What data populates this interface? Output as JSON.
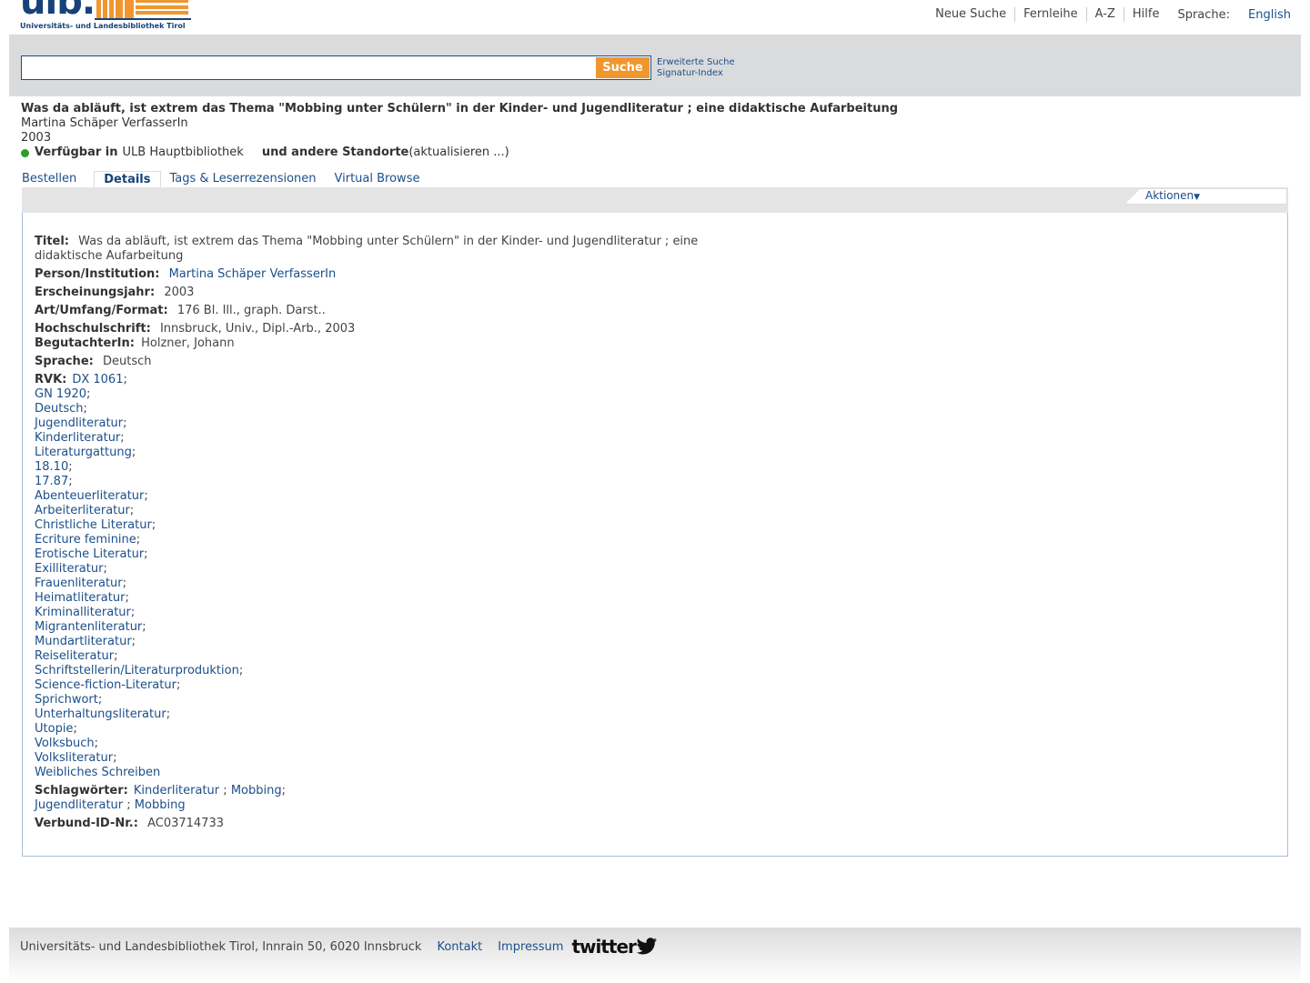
{
  "header": {
    "logo_text": "ulb.",
    "logo_subtitle": "Universitäts- und Landesbibliothek Tirol",
    "nav": [
      "Neue Suche",
      "Fernleihe",
      "A-Z",
      "Hilfe"
    ],
    "language_label": "Sprache:",
    "language_link": "English"
  },
  "search": {
    "value": "",
    "placeholder": "",
    "button_label": "Suche",
    "links": [
      "Erweiterte Suche",
      "Signatur-Index"
    ]
  },
  "record": {
    "title": "Was da abläuft, ist extrem das Thema \"Mobbing unter Schülern\" in der Kinder- und Jugendliteratur ; eine didaktische Aufarbeitung",
    "author": "Martina Schäper VerfasserIn",
    "year": "2003",
    "availability_label": "Verfügbar in",
    "availability_location": "ULB Hauptbibliothek",
    "other_locations": "und andere Standorte",
    "refresh": "(aktualisieren ...)"
  },
  "tabs": [
    "Bestellen",
    "Details",
    "Tags & Leserrezensionen",
    "Virtual Browse"
  ],
  "active_tab": "Details",
  "actions_label": "Aktionen",
  "details": {
    "titel_label": "Titel:",
    "titel_value": "Was da abläuft, ist extrem das Thema \"Mobbing unter Schülern\" in der Kinder- und Jugendliteratur ; eine didaktische Aufarbeitung",
    "person_label": "Person/Institution:",
    "person_value": "Martina Schäper VerfasserIn",
    "jahr_label": "Erscheinungsjahr:",
    "jahr_value": "2003",
    "format_label": "Art/Umfang/Format:",
    "format_value": "176 Bl. Ill., graph. Darst..",
    "hochschul_label": "Hochschulschrift:",
    "hochschul_value": "Innsbruck, Univ., Dipl.-Arb., 2003",
    "gutachter_label": "BegutachterIn:",
    "gutachter_value": "Holzner, Johann",
    "sprache_label": "Sprache:",
    "sprache_value": "Deutsch",
    "rvk_label": "RVK:",
    "rvk": [
      "DX 1061",
      "GN 1920",
      "Deutsch",
      "Jugendliteratur",
      "Kinderliteratur",
      "Literaturgattung",
      "18.10",
      "17.87",
      "Abenteuerliteratur",
      "Arbeiterliteratur",
      "Christliche Literatur",
      "Ecriture feminine",
      "Erotische Literatur",
      "Exilliteratur",
      "Frauenliteratur",
      "Heimatliteratur",
      "Kriminalliteratur",
      "Migrantenliteratur",
      "Mundartliteratur",
      "Reiseliteratur",
      "Schriftstellerin/Literaturproduktion",
      "Science-fiction-Literatur",
      "Sprichwort",
      "Unterhaltungsliteratur",
      "Utopie",
      "Volksbuch",
      "Volksliteratur",
      "Weibliches Schreiben"
    ],
    "schlag_label": "Schlagwörter:",
    "schlag_1a": "Kinderliteratur",
    "schlag_1b": "Mobbing",
    "schlag_2a": "Jugendliteratur",
    "schlag_2b": "Mobbing",
    "verbund_label": "Verbund-ID-Nr.:",
    "verbund_value": "AC03714733"
  },
  "footer": {
    "address": "Universitäts- und Landesbibliothek Tirol, Innrain 50, 6020 Innsbruck",
    "links": [
      "Kontakt",
      "Impressum"
    ],
    "twitter": "twitter"
  },
  "colors": {
    "link": "#1c4f8a",
    "search_button": "#f0962e",
    "available_dot": "#2a9e2a",
    "search_bar_bg": "#dadbdc"
  }
}
